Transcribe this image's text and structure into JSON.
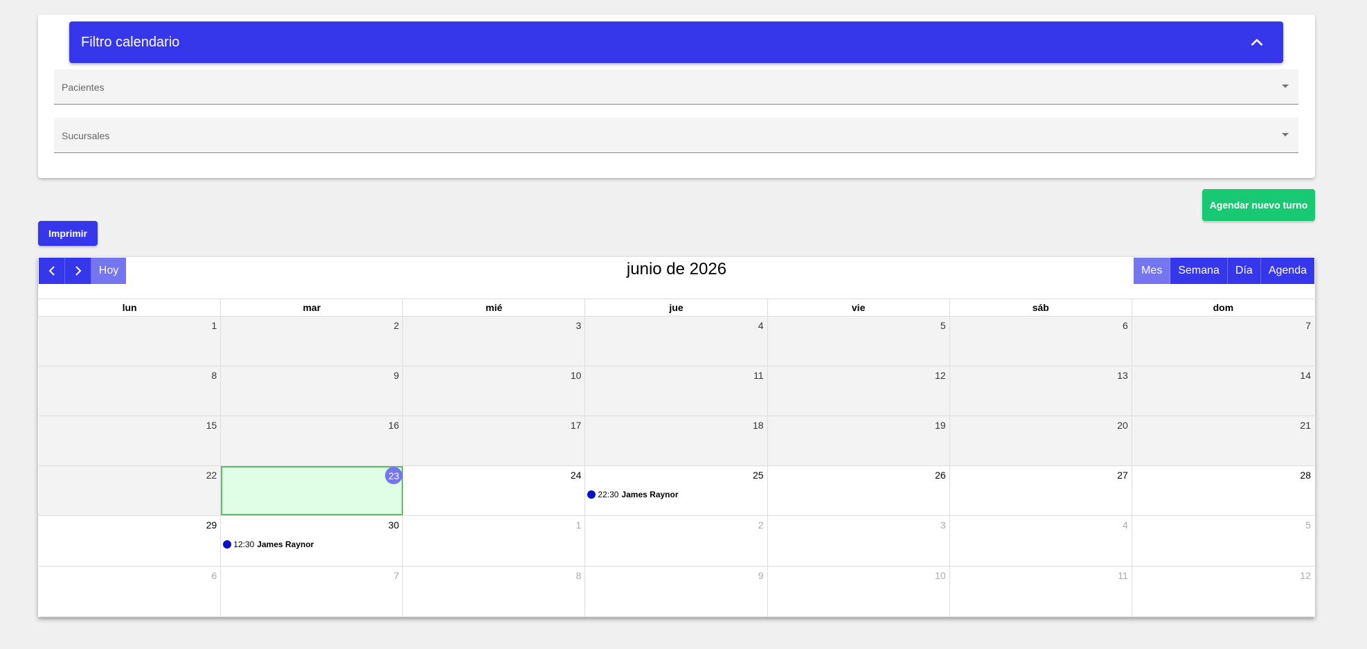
{
  "filter": {
    "title": "Filtro calendario",
    "patients_label": "Pacientes",
    "branches_label": "Sucursales"
  },
  "actions": {
    "new_appointment": "Agendar nuevo turno",
    "print": "Imprimir"
  },
  "calendar": {
    "title": "junio de 2026",
    "today_label": "Hoy",
    "views": [
      "Mes",
      "Semana",
      "Día",
      "Agenda"
    ],
    "active_view": "Mes",
    "weekdays": [
      "lun",
      "mar",
      "mié",
      "jue",
      "vie",
      "sáb",
      "dom"
    ],
    "weeks": [
      [
        {
          "d": "1",
          "s": "past"
        },
        {
          "d": "2",
          "s": "past"
        },
        {
          "d": "3",
          "s": "past"
        },
        {
          "d": "4",
          "s": "past"
        },
        {
          "d": "5",
          "s": "past"
        },
        {
          "d": "6",
          "s": "past"
        },
        {
          "d": "7",
          "s": "past"
        }
      ],
      [
        {
          "d": "8",
          "s": "past"
        },
        {
          "d": "9",
          "s": "past"
        },
        {
          "d": "10",
          "s": "past"
        },
        {
          "d": "11",
          "s": "past"
        },
        {
          "d": "12",
          "s": "past"
        },
        {
          "d": "13",
          "s": "past"
        },
        {
          "d": "14",
          "s": "past"
        }
      ],
      [
        {
          "d": "15",
          "s": "past"
        },
        {
          "d": "16",
          "s": "past"
        },
        {
          "d": "17",
          "s": "past"
        },
        {
          "d": "18",
          "s": "past"
        },
        {
          "d": "19",
          "s": "past"
        },
        {
          "d": "20",
          "s": "past"
        },
        {
          "d": "21",
          "s": "past"
        }
      ],
      [
        {
          "d": "22",
          "s": "past"
        },
        {
          "d": "23",
          "s": "today"
        },
        {
          "d": "24",
          "s": "future"
        },
        {
          "d": "25",
          "s": "future",
          "event": {
            "time": "22:30",
            "title": "James Raynor"
          }
        },
        {
          "d": "26",
          "s": "future"
        },
        {
          "d": "27",
          "s": "future"
        },
        {
          "d": "28",
          "s": "future"
        }
      ],
      [
        {
          "d": "29",
          "s": "future"
        },
        {
          "d": "30",
          "s": "future",
          "event": {
            "time": "12:30",
            "title": "James Raynor"
          }
        },
        {
          "d": "1",
          "s": "other"
        },
        {
          "d": "2",
          "s": "other"
        },
        {
          "d": "3",
          "s": "other"
        },
        {
          "d": "4",
          "s": "other"
        },
        {
          "d": "5",
          "s": "other"
        }
      ],
      [
        {
          "d": "6",
          "s": "other"
        },
        {
          "d": "7",
          "s": "other"
        },
        {
          "d": "8",
          "s": "other"
        },
        {
          "d": "9",
          "s": "other"
        },
        {
          "d": "10",
          "s": "other"
        },
        {
          "d": "11",
          "s": "other"
        },
        {
          "d": "12",
          "s": "other"
        }
      ]
    ]
  },
  "colors": {
    "primary": "#3637ea",
    "active_view": "#7475ef",
    "success": "#18c872",
    "event_dot": "#0a11c5",
    "today_bg": "#e0fde6"
  },
  "icons": {
    "collapse": "chevron-up-icon",
    "prev": "chevron-left-icon",
    "next": "chevron-right-icon",
    "select": "caret-down-icon"
  }
}
